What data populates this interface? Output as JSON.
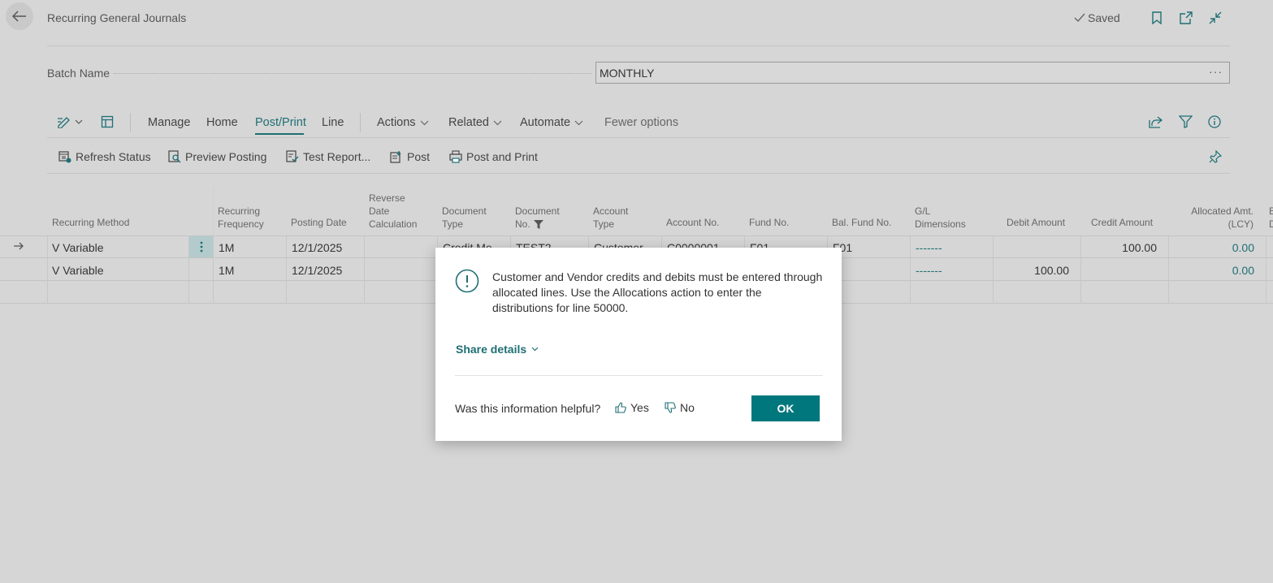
{
  "header": {
    "title": "Recurring General Journals",
    "saved_label": "Saved"
  },
  "batch": {
    "label": "Batch Name",
    "value": "MONTHLY",
    "more": "···"
  },
  "menu": {
    "manage": "Manage",
    "home": "Home",
    "post_print": "Post/Print",
    "line": "Line",
    "actions": "Actions",
    "related": "Related",
    "automate": "Automate",
    "fewer_options": "Fewer options"
  },
  "subactions": {
    "refresh_status": "Refresh Status",
    "preview_posting": "Preview Posting",
    "test_report": "Test Report...",
    "post": "Post",
    "post_and_print": "Post and Print"
  },
  "columns": {
    "recurring_method": "Recurring Method",
    "recurring_frequency": [
      "Recurring",
      "Frequency"
    ],
    "posting_date": "Posting Date",
    "reverse_date_calc": [
      "Reverse",
      "Date",
      "Calculation"
    ],
    "document_type": [
      "Document",
      "Type"
    ],
    "document_no": [
      "Document",
      "No."
    ],
    "account_type": [
      "Account",
      "Type"
    ],
    "account_no": "Account No.",
    "fund_no": "Fund No.",
    "bal_fund_no": "Bal. Fund No.",
    "gl_dimensions": [
      "G/L",
      "Dimensions"
    ],
    "debit_amount": "Debit Amount",
    "credit_amount": "Credit Amount",
    "allocated_amt": [
      "Allocated Amt.",
      "(LCY)"
    ],
    "next_col": [
      "E",
      "D"
    ]
  },
  "rows": [
    {
      "method": "V Variable",
      "frequency": "1M",
      "posting_date": "12/1/2025",
      "doc_type": "Credit Me",
      "doc_no": "TEST2",
      "account_type": "Customer",
      "account_no": "C0000001",
      "fund_no": "F01",
      "bal_fund_no": "F01",
      "dims": "-------",
      "debit": "",
      "credit": "100.00",
      "allocated": "0.00"
    },
    {
      "method": "V  Variable",
      "frequency": "1M",
      "posting_date": "12/1/2025",
      "dims": "-------",
      "debit": "100.00",
      "credit": "",
      "allocated": "0.00"
    }
  ],
  "dialog": {
    "message": "Customer and Vendor credits and debits must be entered through allocated lines. Use the Allocations action to enter the distributions for line 50000.",
    "share_details": "Share details",
    "helpful_question": "Was this information helpful?",
    "yes": "Yes",
    "no": "No",
    "ok": "OK"
  },
  "colors": {
    "accent": "#00777d",
    "link": "#1f6f74"
  }
}
